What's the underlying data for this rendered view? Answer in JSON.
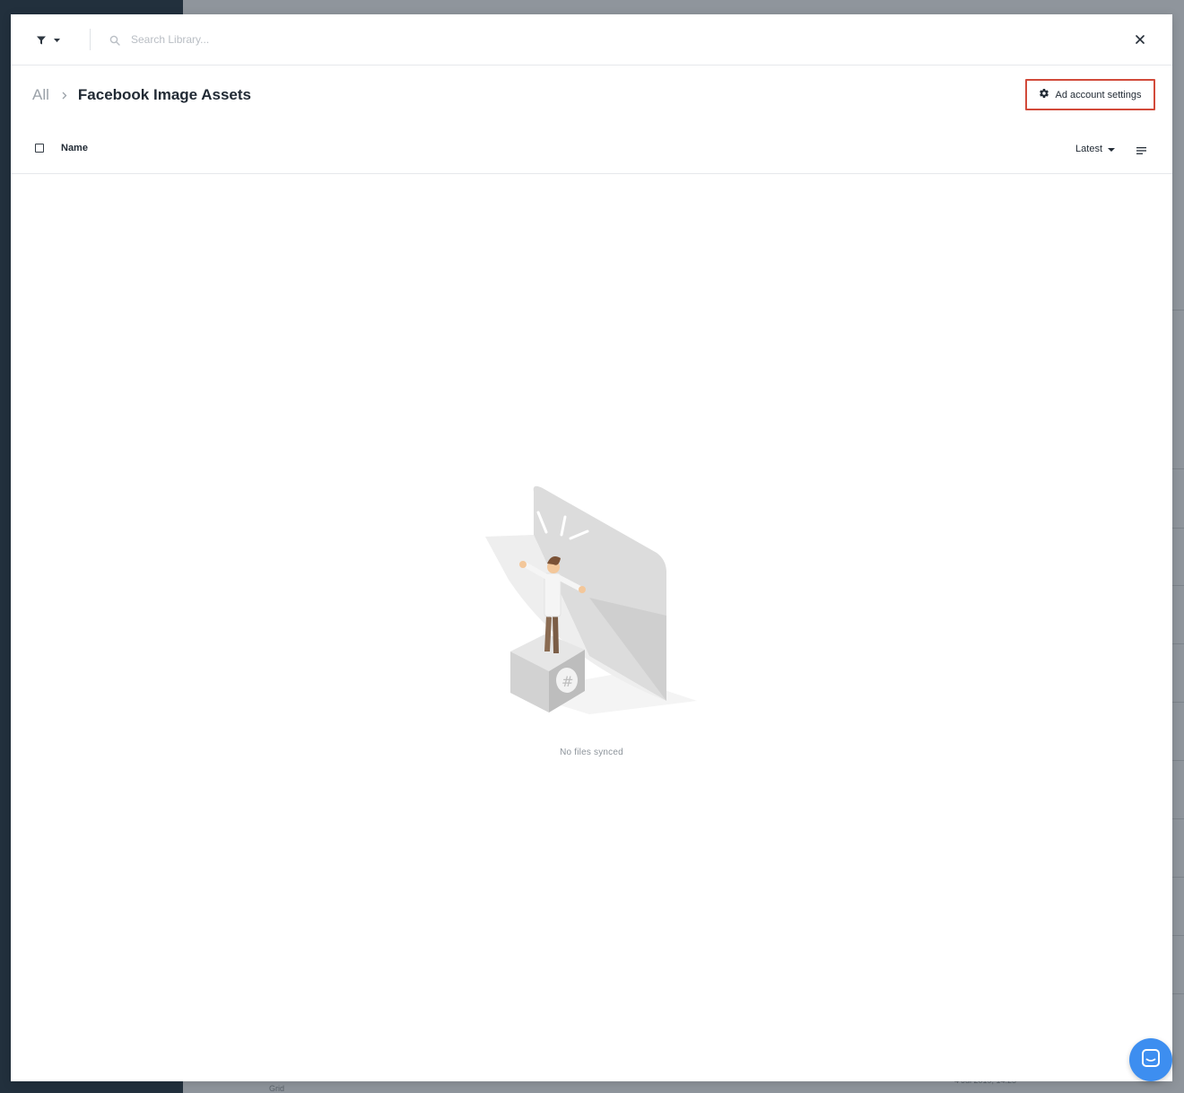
{
  "search": {
    "placeholder": "Search Library..."
  },
  "breadcrumb": {
    "root": "All",
    "current": "Facebook Image Assets"
  },
  "settings_button": {
    "label": "Ad account settings"
  },
  "table": {
    "column_name": "Name",
    "sort_label": "Latest"
  },
  "empty_state": {
    "message": "No files synced"
  },
  "background": {
    "footer_label": "Grid",
    "footer_date": "4 Jul 2019, 14:25"
  },
  "colors": {
    "accent_border": "#d24a3a",
    "chat_button": "#3d8ef0",
    "sidebar": "#22303d"
  }
}
